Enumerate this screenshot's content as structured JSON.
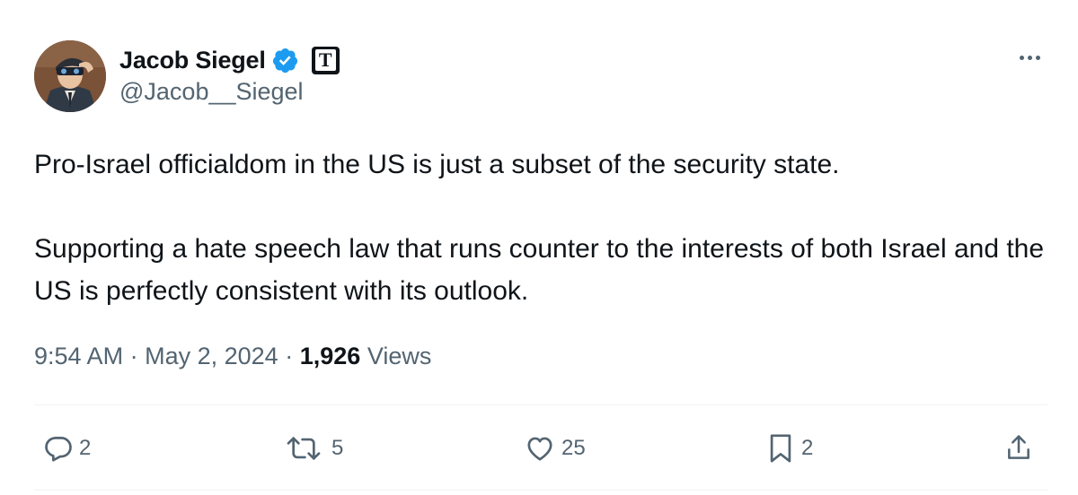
{
  "author": {
    "display_name": "Jacob Siegel",
    "handle": "@Jacob__Siegel",
    "verified_icon": "verified-badge-icon",
    "affiliation_badge_letter": "T"
  },
  "tweet": {
    "paragraphs": [
      "Pro-Israel officialdom in the US is just a subset of the security state.",
      "Supporting a hate speech law that runs counter to the interests of both Israel and the US is perfectly consistent with its outlook."
    ]
  },
  "meta": {
    "time": "9:54 AM",
    "separator": "·",
    "date": "May 2, 2024",
    "views_count": "1,926",
    "views_label": "Views"
  },
  "actions": {
    "replies": "2",
    "reposts": "5",
    "likes": "25",
    "bookmarks": "2"
  },
  "colors": {
    "text_primary": "#0f1419",
    "text_secondary": "#536471",
    "verified_blue": "#1d9bf0",
    "divider": "#eff3f4"
  }
}
